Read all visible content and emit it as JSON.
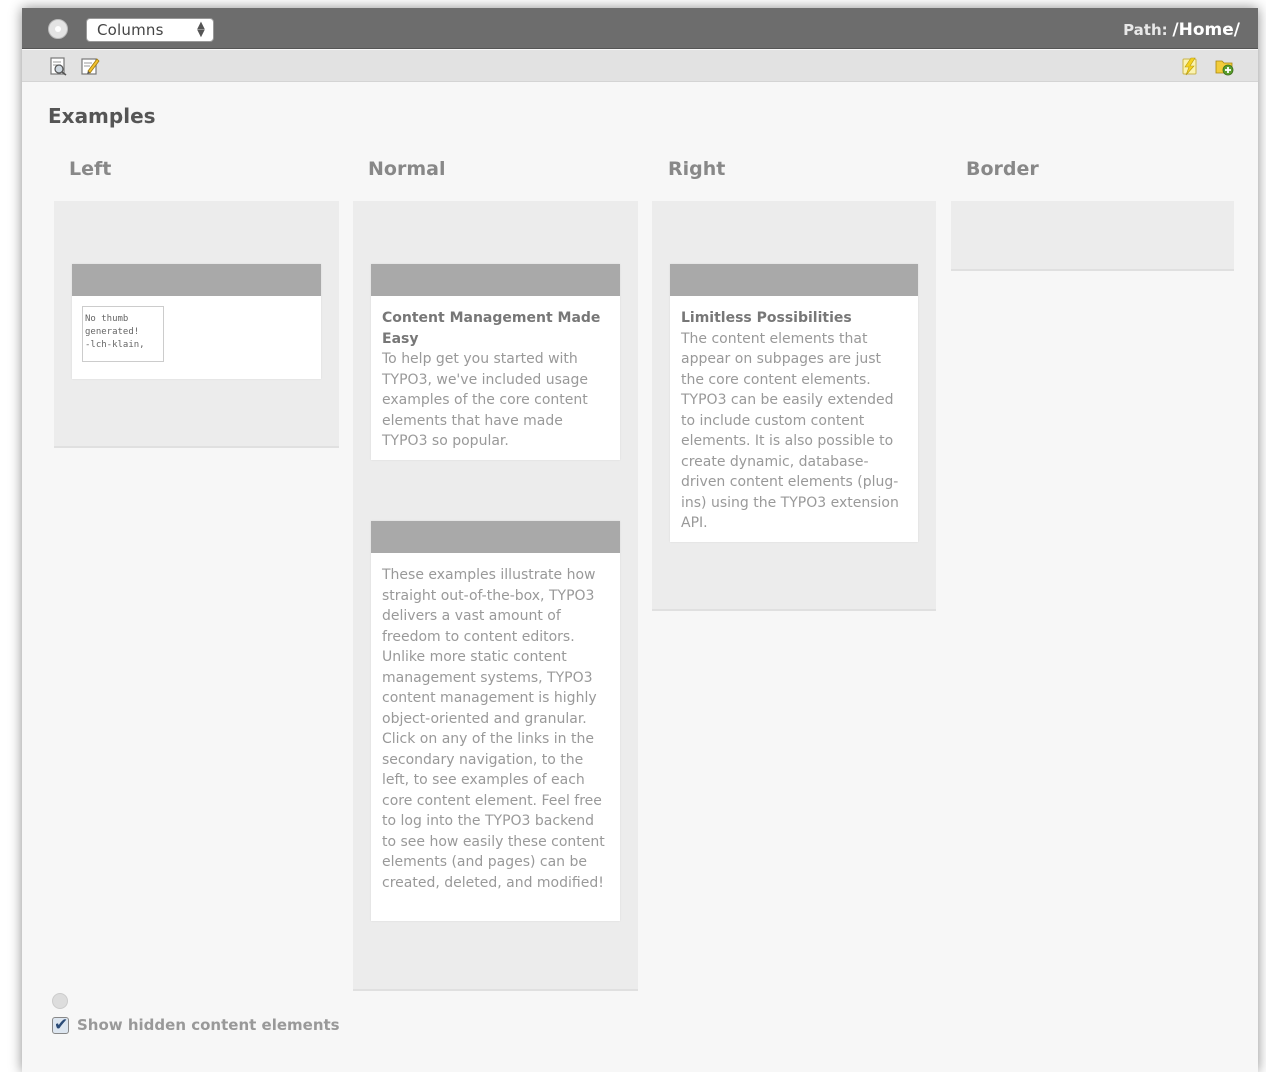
{
  "topbar": {
    "view_select": "Columns",
    "path_label": "Path:",
    "path_value": "/Home/"
  },
  "page": {
    "title": "Examples"
  },
  "columns": [
    {
      "label": "Left"
    },
    {
      "label": "Normal"
    },
    {
      "label": "Right"
    },
    {
      "label": "Border"
    }
  ],
  "left": {
    "image_thumb_text": [
      "No thumb",
      "generated!",
      "-lch-klain,"
    ]
  },
  "normal": {
    "ce1": {
      "title": "Content Management Made Easy",
      "text": "To help get you started with TYPO3, we've included usage examples of the core content elements that have made TYPO3 so popular."
    },
    "ce2": {
      "text": "These examples illustrate how straight out-of-the-box, TYPO3 delivers a vast amount of freedom to content editors. Unlike more static content management systems, TYPO3 content management is highly object-oriented and granular. Click on any of the links in the secondary navigation, to the left, to see examples of each core content element. Feel free to log into the TYPO3 backend to see how easily these content elements (and pages) can be created, deleted, and modified!"
    }
  },
  "right": {
    "ce1": {
      "title": "Limitless Possibilities",
      "text": "The content elements that appear on subpages are just the core content elements. TYPO3 can be easily extended to include custom content elements. It is also possible to create dynamic, database-driven content elements (plug-ins) using the TYPO3 extension API."
    }
  },
  "footer": {
    "show_hidden_label": "Show hidden content elements"
  },
  "icons": {
    "help": "help-icon",
    "view": "view-page-icon",
    "edit": "edit-page-icon",
    "clear_cache": "clear-cache-icon",
    "new": "new-record-icon"
  }
}
